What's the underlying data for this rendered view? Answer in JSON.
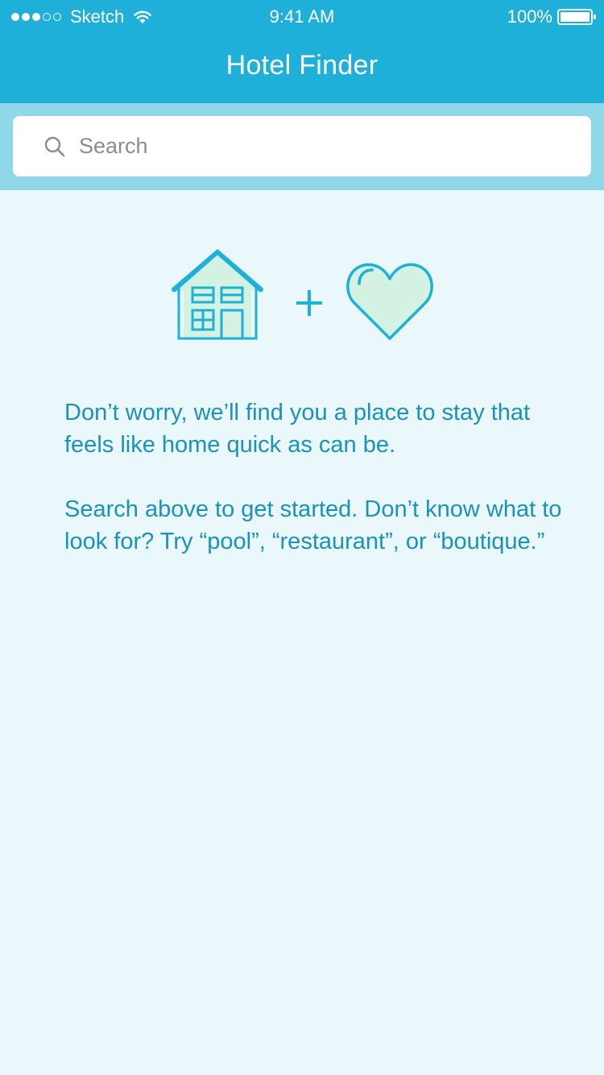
{
  "status_bar": {
    "carrier": "Sketch",
    "time": "9:41 AM",
    "battery": "100%"
  },
  "nav": {
    "title": "Hotel Finder"
  },
  "search": {
    "placeholder": "Search",
    "value": ""
  },
  "hero": {
    "icons": [
      "house-icon",
      "plus-icon",
      "heart-icon"
    ]
  },
  "message": {
    "paragraph_1": "Don’t worry, we’ll find you a place to stay that feels like home quick as can be.",
    "paragraph_2": "Search above to get started. Don’t know what to look for? Try “pool”, “restaurant”, or “boutique.”"
  },
  "colors": {
    "brand": "#1eb0d8",
    "search_band": "#8ed8ea",
    "background": "#eaf7fb",
    "text": "#1a93b8",
    "icon_fill": "#d4f2e2"
  }
}
